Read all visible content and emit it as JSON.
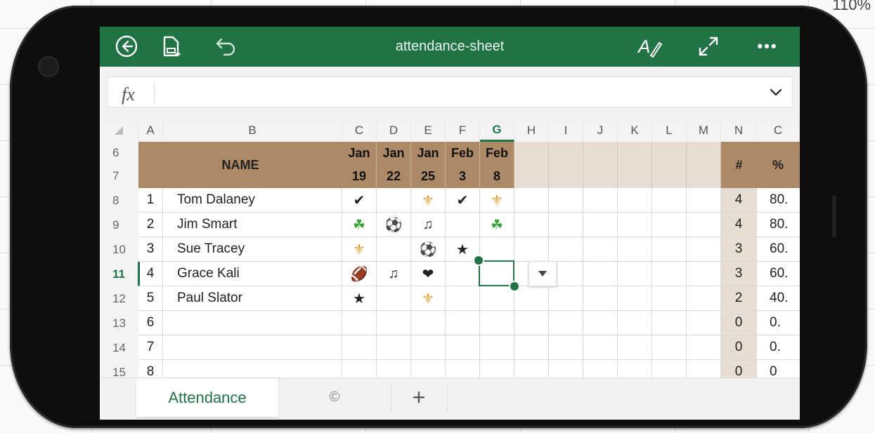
{
  "background_fragment": {
    "corner_text": "110%"
  },
  "app": {
    "title": "attendance-sheet",
    "accent_color": "#217346"
  },
  "toolbar": {
    "back_icon": "back-circle-icon",
    "file_icon": "file-save-icon",
    "undo_icon": "undo-icon",
    "format_icon": "text-format-icon",
    "fullscreen_icon": "expand-icon",
    "more_label": "•••"
  },
  "formula_bar": {
    "fx_label": "fx",
    "value": "",
    "chevron_icon": "chevron-down-icon"
  },
  "columns": [
    "A",
    "B",
    "C",
    "D",
    "E",
    "F",
    "G",
    "H",
    "I",
    "J",
    "K",
    "L",
    "M",
    "N",
    "C"
  ],
  "selected_column": "G",
  "row_numbers": [
    "6",
    "7",
    "8",
    "9",
    "10",
    "11",
    "12",
    "13",
    "14",
    "15"
  ],
  "selected_row": "11",
  "header": {
    "name_label": "NAME",
    "dates": [
      {
        "month": "Jan",
        "day": "19"
      },
      {
        "month": "Jan",
        "day": "22"
      },
      {
        "month": "Jan",
        "day": "25"
      },
      {
        "month": "Feb",
        "day": "3"
      },
      {
        "month": "Feb",
        "day": "8"
      }
    ],
    "count_label": "#",
    "percent_label": "%"
  },
  "rows": [
    {
      "num": "1",
      "name": "Tom Dalaney",
      "marks": [
        "✔",
        "",
        "⚜",
        "✔",
        "⚜"
      ],
      "count": "4",
      "percent": "80."
    },
    {
      "num": "2",
      "name": "Jim Smart",
      "marks": [
        "☘",
        "⚽",
        "♫",
        "",
        "☘"
      ],
      "count": "4",
      "percent": "80."
    },
    {
      "num": "3",
      "name": "Sue Tracey",
      "marks": [
        "⚜",
        "",
        "⚽",
        "★",
        ""
      ],
      "count": "3",
      "percent": "60."
    },
    {
      "num": "4",
      "name": "Grace Kali",
      "marks": [
        "🏈",
        "♫",
        "❤",
        "",
        ""
      ],
      "count": "3",
      "percent": "60."
    },
    {
      "num": "5",
      "name": "Paul Slator",
      "marks": [
        "★",
        "",
        "⚜",
        "",
        ""
      ],
      "count": "2",
      "percent": "40."
    },
    {
      "num": "6",
      "name": "",
      "marks": [
        "",
        "",
        "",
        "",
        ""
      ],
      "count": "0",
      "percent": "0."
    },
    {
      "num": "7",
      "name": "",
      "marks": [
        "",
        "",
        "",
        "",
        ""
      ],
      "count": "0",
      "percent": "0."
    },
    {
      "num": "8",
      "name": "",
      "marks": [
        "",
        "",
        "",
        "",
        ""
      ],
      "count": "0",
      "percent": "0"
    }
  ],
  "mark_colors": {
    "check": "#222222",
    "fleur": "#d8a23a",
    "clover": "#3aa33a",
    "ball": "#333333",
    "note": "#333333",
    "star": "#222222",
    "football": "#8a4b1e",
    "heart": "#222222"
  },
  "sheet_tabs": {
    "active": "Attendance",
    "second_icon": "©",
    "add_label": "+"
  }
}
